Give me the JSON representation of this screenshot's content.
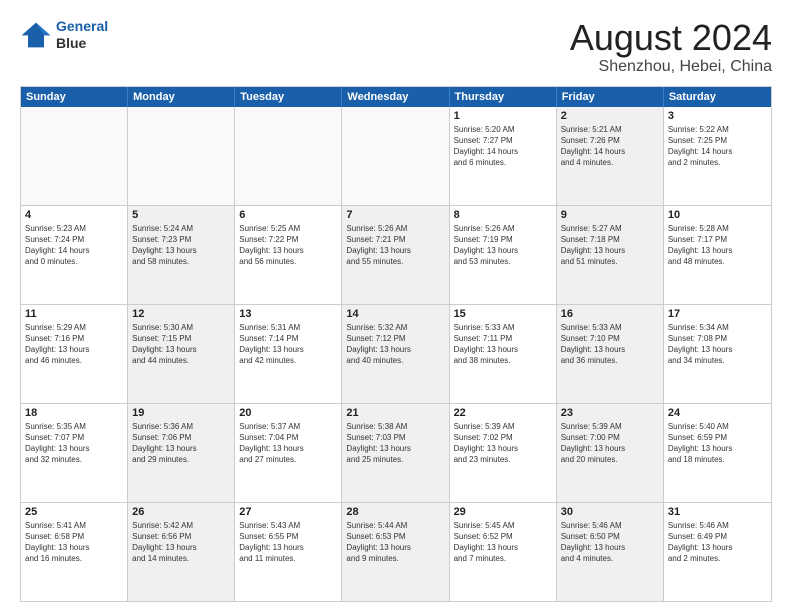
{
  "logo": {
    "line1": "General",
    "line2": "Blue"
  },
  "title": "August 2024",
  "subtitle": "Shenzhou, Hebei, China",
  "weekdays": [
    "Sunday",
    "Monday",
    "Tuesday",
    "Wednesday",
    "Thursday",
    "Friday",
    "Saturday"
  ],
  "weeks": [
    [
      {
        "day": "",
        "text": "",
        "empty": true
      },
      {
        "day": "",
        "text": "",
        "empty": true
      },
      {
        "day": "",
        "text": "",
        "empty": true
      },
      {
        "day": "",
        "text": "",
        "empty": true
      },
      {
        "day": "1",
        "text": "Sunrise: 5:20 AM\nSunset: 7:27 PM\nDaylight: 14 hours\nand 6 minutes.",
        "empty": false,
        "shaded": false
      },
      {
        "day": "2",
        "text": "Sunrise: 5:21 AM\nSunset: 7:26 PM\nDaylight: 14 hours\nand 4 minutes.",
        "empty": false,
        "shaded": true
      },
      {
        "day": "3",
        "text": "Sunrise: 5:22 AM\nSunset: 7:25 PM\nDaylight: 14 hours\nand 2 minutes.",
        "empty": false,
        "shaded": false
      }
    ],
    [
      {
        "day": "4",
        "text": "Sunrise: 5:23 AM\nSunset: 7:24 PM\nDaylight: 14 hours\nand 0 minutes.",
        "empty": false,
        "shaded": false
      },
      {
        "day": "5",
        "text": "Sunrise: 5:24 AM\nSunset: 7:23 PM\nDaylight: 13 hours\nand 58 minutes.",
        "empty": false,
        "shaded": true
      },
      {
        "day": "6",
        "text": "Sunrise: 5:25 AM\nSunset: 7:22 PM\nDaylight: 13 hours\nand 56 minutes.",
        "empty": false,
        "shaded": false
      },
      {
        "day": "7",
        "text": "Sunrise: 5:26 AM\nSunset: 7:21 PM\nDaylight: 13 hours\nand 55 minutes.",
        "empty": false,
        "shaded": true
      },
      {
        "day": "8",
        "text": "Sunrise: 5:26 AM\nSunset: 7:19 PM\nDaylight: 13 hours\nand 53 minutes.",
        "empty": false,
        "shaded": false
      },
      {
        "day": "9",
        "text": "Sunrise: 5:27 AM\nSunset: 7:18 PM\nDaylight: 13 hours\nand 51 minutes.",
        "empty": false,
        "shaded": true
      },
      {
        "day": "10",
        "text": "Sunrise: 5:28 AM\nSunset: 7:17 PM\nDaylight: 13 hours\nand 48 minutes.",
        "empty": false,
        "shaded": false
      }
    ],
    [
      {
        "day": "11",
        "text": "Sunrise: 5:29 AM\nSunset: 7:16 PM\nDaylight: 13 hours\nand 46 minutes.",
        "empty": false,
        "shaded": false
      },
      {
        "day": "12",
        "text": "Sunrise: 5:30 AM\nSunset: 7:15 PM\nDaylight: 13 hours\nand 44 minutes.",
        "empty": false,
        "shaded": true
      },
      {
        "day": "13",
        "text": "Sunrise: 5:31 AM\nSunset: 7:14 PM\nDaylight: 13 hours\nand 42 minutes.",
        "empty": false,
        "shaded": false
      },
      {
        "day": "14",
        "text": "Sunrise: 5:32 AM\nSunset: 7:12 PM\nDaylight: 13 hours\nand 40 minutes.",
        "empty": false,
        "shaded": true
      },
      {
        "day": "15",
        "text": "Sunrise: 5:33 AM\nSunset: 7:11 PM\nDaylight: 13 hours\nand 38 minutes.",
        "empty": false,
        "shaded": false
      },
      {
        "day": "16",
        "text": "Sunrise: 5:33 AM\nSunset: 7:10 PM\nDaylight: 13 hours\nand 36 minutes.",
        "empty": false,
        "shaded": true
      },
      {
        "day": "17",
        "text": "Sunrise: 5:34 AM\nSunset: 7:08 PM\nDaylight: 13 hours\nand 34 minutes.",
        "empty": false,
        "shaded": false
      }
    ],
    [
      {
        "day": "18",
        "text": "Sunrise: 5:35 AM\nSunset: 7:07 PM\nDaylight: 13 hours\nand 32 minutes.",
        "empty": false,
        "shaded": false
      },
      {
        "day": "19",
        "text": "Sunrise: 5:36 AM\nSunset: 7:06 PM\nDaylight: 13 hours\nand 29 minutes.",
        "empty": false,
        "shaded": true
      },
      {
        "day": "20",
        "text": "Sunrise: 5:37 AM\nSunset: 7:04 PM\nDaylight: 13 hours\nand 27 minutes.",
        "empty": false,
        "shaded": false
      },
      {
        "day": "21",
        "text": "Sunrise: 5:38 AM\nSunset: 7:03 PM\nDaylight: 13 hours\nand 25 minutes.",
        "empty": false,
        "shaded": true
      },
      {
        "day": "22",
        "text": "Sunrise: 5:39 AM\nSunset: 7:02 PM\nDaylight: 13 hours\nand 23 minutes.",
        "empty": false,
        "shaded": false
      },
      {
        "day": "23",
        "text": "Sunrise: 5:39 AM\nSunset: 7:00 PM\nDaylight: 13 hours\nand 20 minutes.",
        "empty": false,
        "shaded": true
      },
      {
        "day": "24",
        "text": "Sunrise: 5:40 AM\nSunset: 6:59 PM\nDaylight: 13 hours\nand 18 minutes.",
        "empty": false,
        "shaded": false
      }
    ],
    [
      {
        "day": "25",
        "text": "Sunrise: 5:41 AM\nSunset: 6:58 PM\nDaylight: 13 hours\nand 16 minutes.",
        "empty": false,
        "shaded": false
      },
      {
        "day": "26",
        "text": "Sunrise: 5:42 AM\nSunset: 6:56 PM\nDaylight: 13 hours\nand 14 minutes.",
        "empty": false,
        "shaded": true
      },
      {
        "day": "27",
        "text": "Sunrise: 5:43 AM\nSunset: 6:55 PM\nDaylight: 13 hours\nand 11 minutes.",
        "empty": false,
        "shaded": false
      },
      {
        "day": "28",
        "text": "Sunrise: 5:44 AM\nSunset: 6:53 PM\nDaylight: 13 hours\nand 9 minutes.",
        "empty": false,
        "shaded": true
      },
      {
        "day": "29",
        "text": "Sunrise: 5:45 AM\nSunset: 6:52 PM\nDaylight: 13 hours\nand 7 minutes.",
        "empty": false,
        "shaded": false
      },
      {
        "day": "30",
        "text": "Sunrise: 5:46 AM\nSunset: 6:50 PM\nDaylight: 13 hours\nand 4 minutes.",
        "empty": false,
        "shaded": true
      },
      {
        "day": "31",
        "text": "Sunrise: 5:46 AM\nSunset: 6:49 PM\nDaylight: 13 hours\nand 2 minutes.",
        "empty": false,
        "shaded": false
      }
    ]
  ]
}
